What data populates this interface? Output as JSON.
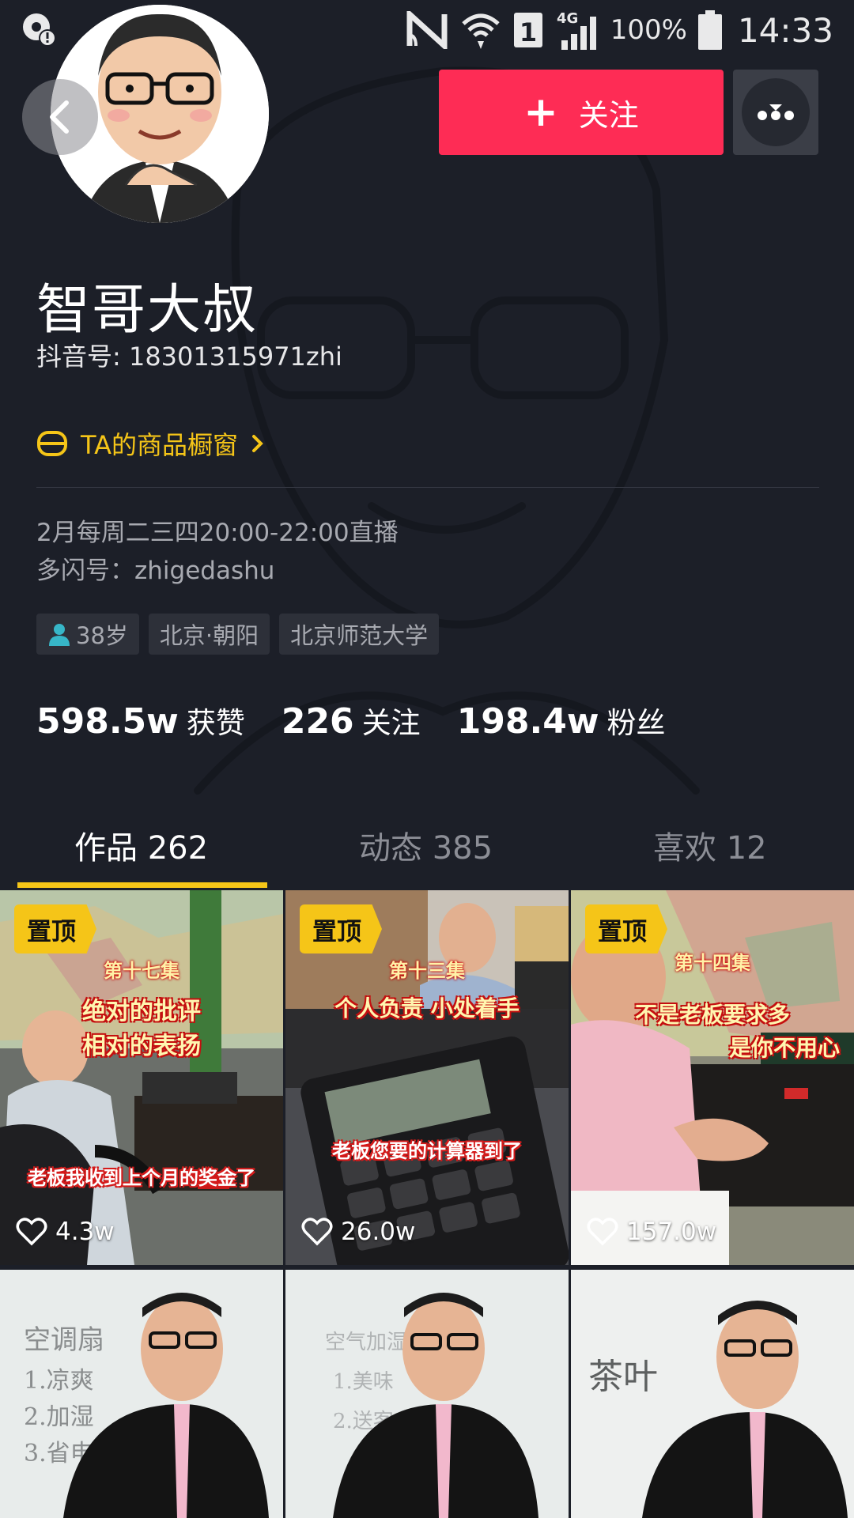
{
  "status_bar": {
    "battery_percent": "100%",
    "time": "14:33",
    "network_label": "4G",
    "sim_label": "1"
  },
  "header": {
    "follow_label": "关注",
    "follow_plus": "+"
  },
  "profile": {
    "nickname": "智哥大叔",
    "douyin_id": "抖音号: 18301315971zhi",
    "shop_label": "TA的商品橱窗",
    "bio_line1": "2月每周二三四20:00-22:00直播",
    "bio_line2": "多闪号：zhigedashu",
    "tags": {
      "age": "38岁",
      "location": "北京·朝阳",
      "school": "北京师范大学"
    },
    "stats": {
      "likes_value": "598.5w",
      "likes_label": "获赞",
      "following_value": "226",
      "following_label": "关注",
      "followers_value": "198.4w",
      "followers_label": "粉丝"
    }
  },
  "tabs": {
    "works": "作品 262",
    "moments": "动态 385",
    "liked": "喜欢 12"
  },
  "videos": [
    {
      "pinned_label": "置顶",
      "episode": "第十七集",
      "caption_line1": "绝对的批评",
      "caption_line2": "相对的表扬",
      "subtitle": "老板我收到上个月的奖金了",
      "likes": "4.3w"
    },
    {
      "pinned_label": "置顶",
      "episode": "第十三集",
      "caption_line1": "个人负责 小处着手",
      "subtitle": "老板您要的计算器到了",
      "likes": "26.0w"
    },
    {
      "pinned_label": "置顶",
      "episode": "第十四集",
      "caption_line1": "不是老板要求多",
      "caption_line2": "是你不用心",
      "likes": "157.0w"
    },
    {
      "board_lines": [
        "空调扇",
        "1.凉爽",
        "2.加湿",
        "3.省电"
      ]
    },
    {
      "board_lines": [
        "空气加湿",
        "1.美味",
        "2.送客"
      ]
    },
    {
      "board_lines": [
        "茶叶"
      ]
    }
  ],
  "colors": {
    "background": "#1c1f28",
    "follow_button": "#fe2c55",
    "accent_yellow": "#f5c518",
    "muted_text": "#a8aab1"
  }
}
